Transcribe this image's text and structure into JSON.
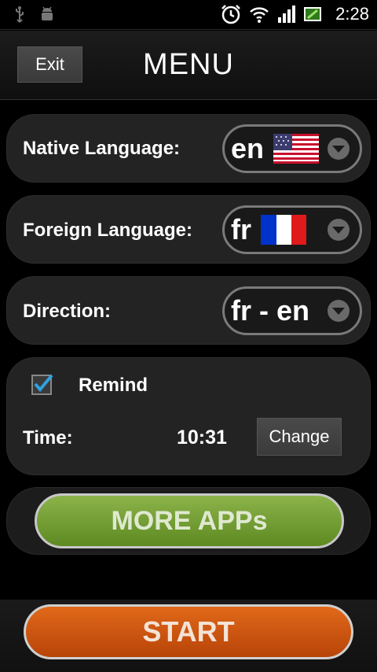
{
  "status": {
    "time": "2:28"
  },
  "header": {
    "exit_label": "Exit",
    "title": "MENU"
  },
  "native": {
    "label": "Native Language:",
    "value": "en"
  },
  "foreign": {
    "label": "Foreign Language:",
    "value": "fr"
  },
  "direction": {
    "label": "Direction:",
    "value": "fr - en"
  },
  "remind": {
    "label": "Remind",
    "checked": true,
    "time_label": "Time:",
    "time_value": "10:31",
    "change_label": "Change"
  },
  "more_apps": {
    "label": "MORE APPs"
  },
  "start": {
    "label": "START"
  },
  "colors": {
    "accent_green": "#6f9a2e",
    "accent_orange": "#d05a10",
    "checkmark": "#2fa3e0"
  }
}
